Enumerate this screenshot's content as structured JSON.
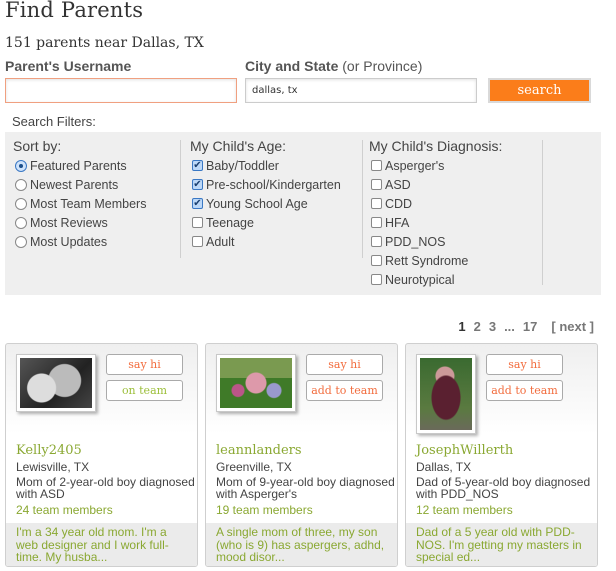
{
  "header": {
    "title": "Find Parents",
    "subtitle": "151 parents near Dallas, TX"
  },
  "search": {
    "username_label": "Parent's Username",
    "username_value": "",
    "city_label": "City and State",
    "city_label_hint": "(or Province)",
    "city_value": "dallas, tx",
    "search_button": "search"
  },
  "filters": {
    "label": "Search Filters:",
    "sort": {
      "title": "Sort by:",
      "options": [
        {
          "label": "Featured Parents",
          "selected": true
        },
        {
          "label": "Newest Parents",
          "selected": false
        },
        {
          "label": "Most Team Members",
          "selected": false
        },
        {
          "label": "Most Reviews",
          "selected": false
        },
        {
          "label": "Most Updates",
          "selected": false
        }
      ]
    },
    "age": {
      "title": "My Child's Age:",
      "options": [
        {
          "label": "Baby/Toddler",
          "checked": true
        },
        {
          "label": "Pre-school/Kindergarten",
          "checked": true
        },
        {
          "label": "Young School Age",
          "checked": true
        },
        {
          "label": "Teenage",
          "checked": false
        },
        {
          "label": "Adult",
          "checked": false
        }
      ]
    },
    "diagnosis": {
      "title": "My Child's Diagnosis:",
      "options": [
        {
          "label": "Asperger's",
          "checked": false
        },
        {
          "label": "ASD",
          "checked": false
        },
        {
          "label": "CDD",
          "checked": false
        },
        {
          "label": "HFA",
          "checked": false
        },
        {
          "label": "PDD_NOS",
          "checked": false
        },
        {
          "label": "Rett Syndrome",
          "checked": false
        },
        {
          "label": "Neurotypical",
          "checked": false
        }
      ]
    }
  },
  "pagination": {
    "pages": [
      "1",
      "2",
      "3",
      "...",
      "17"
    ],
    "current": "1",
    "next": "[ next ]"
  },
  "colors": {
    "accent_orange": "#fb7d1a",
    "name_green": "#8aa832",
    "button_text_orange": "#f26c3d"
  },
  "cards": [
    {
      "photo": "mother-and-toddler-bw-photo",
      "say_hi": "say hi",
      "team_button": "on team",
      "on_team": true,
      "username": "Kelly2405",
      "location": "Lewisville, TX",
      "description": "Mom of 2-year-old boy diagnosed with ASD",
      "team_members": "24 team members",
      "bio": "I'm a 34 year old mom. I'm a web designer and I work full-time. My husba..."
    },
    {
      "photo": "family-on-grass-photo",
      "say_hi": "say hi",
      "team_button": "add to team",
      "on_team": false,
      "username": "leannlanders",
      "location": "Greenville, TX",
      "description": "Mom of 9-year-old boy diagnosed with Asperger's",
      "team_members": "19 team members",
      "bio": "A single mom of three, my son (who is 9) has aspergers, adhd, mood disor..."
    },
    {
      "photo": "boy-in-jersey-photo",
      "say_hi": "say hi",
      "team_button": "add to team",
      "on_team": false,
      "username": "JosephWillerth",
      "location": "Dallas, TX",
      "description": "Dad of 5-year-old boy diagnosed with PDD_NOS",
      "team_members": "12 team members",
      "bio": "Dad of a 5 year old with PDD-NOS. I'm getting my masters in special ed..."
    }
  ]
}
